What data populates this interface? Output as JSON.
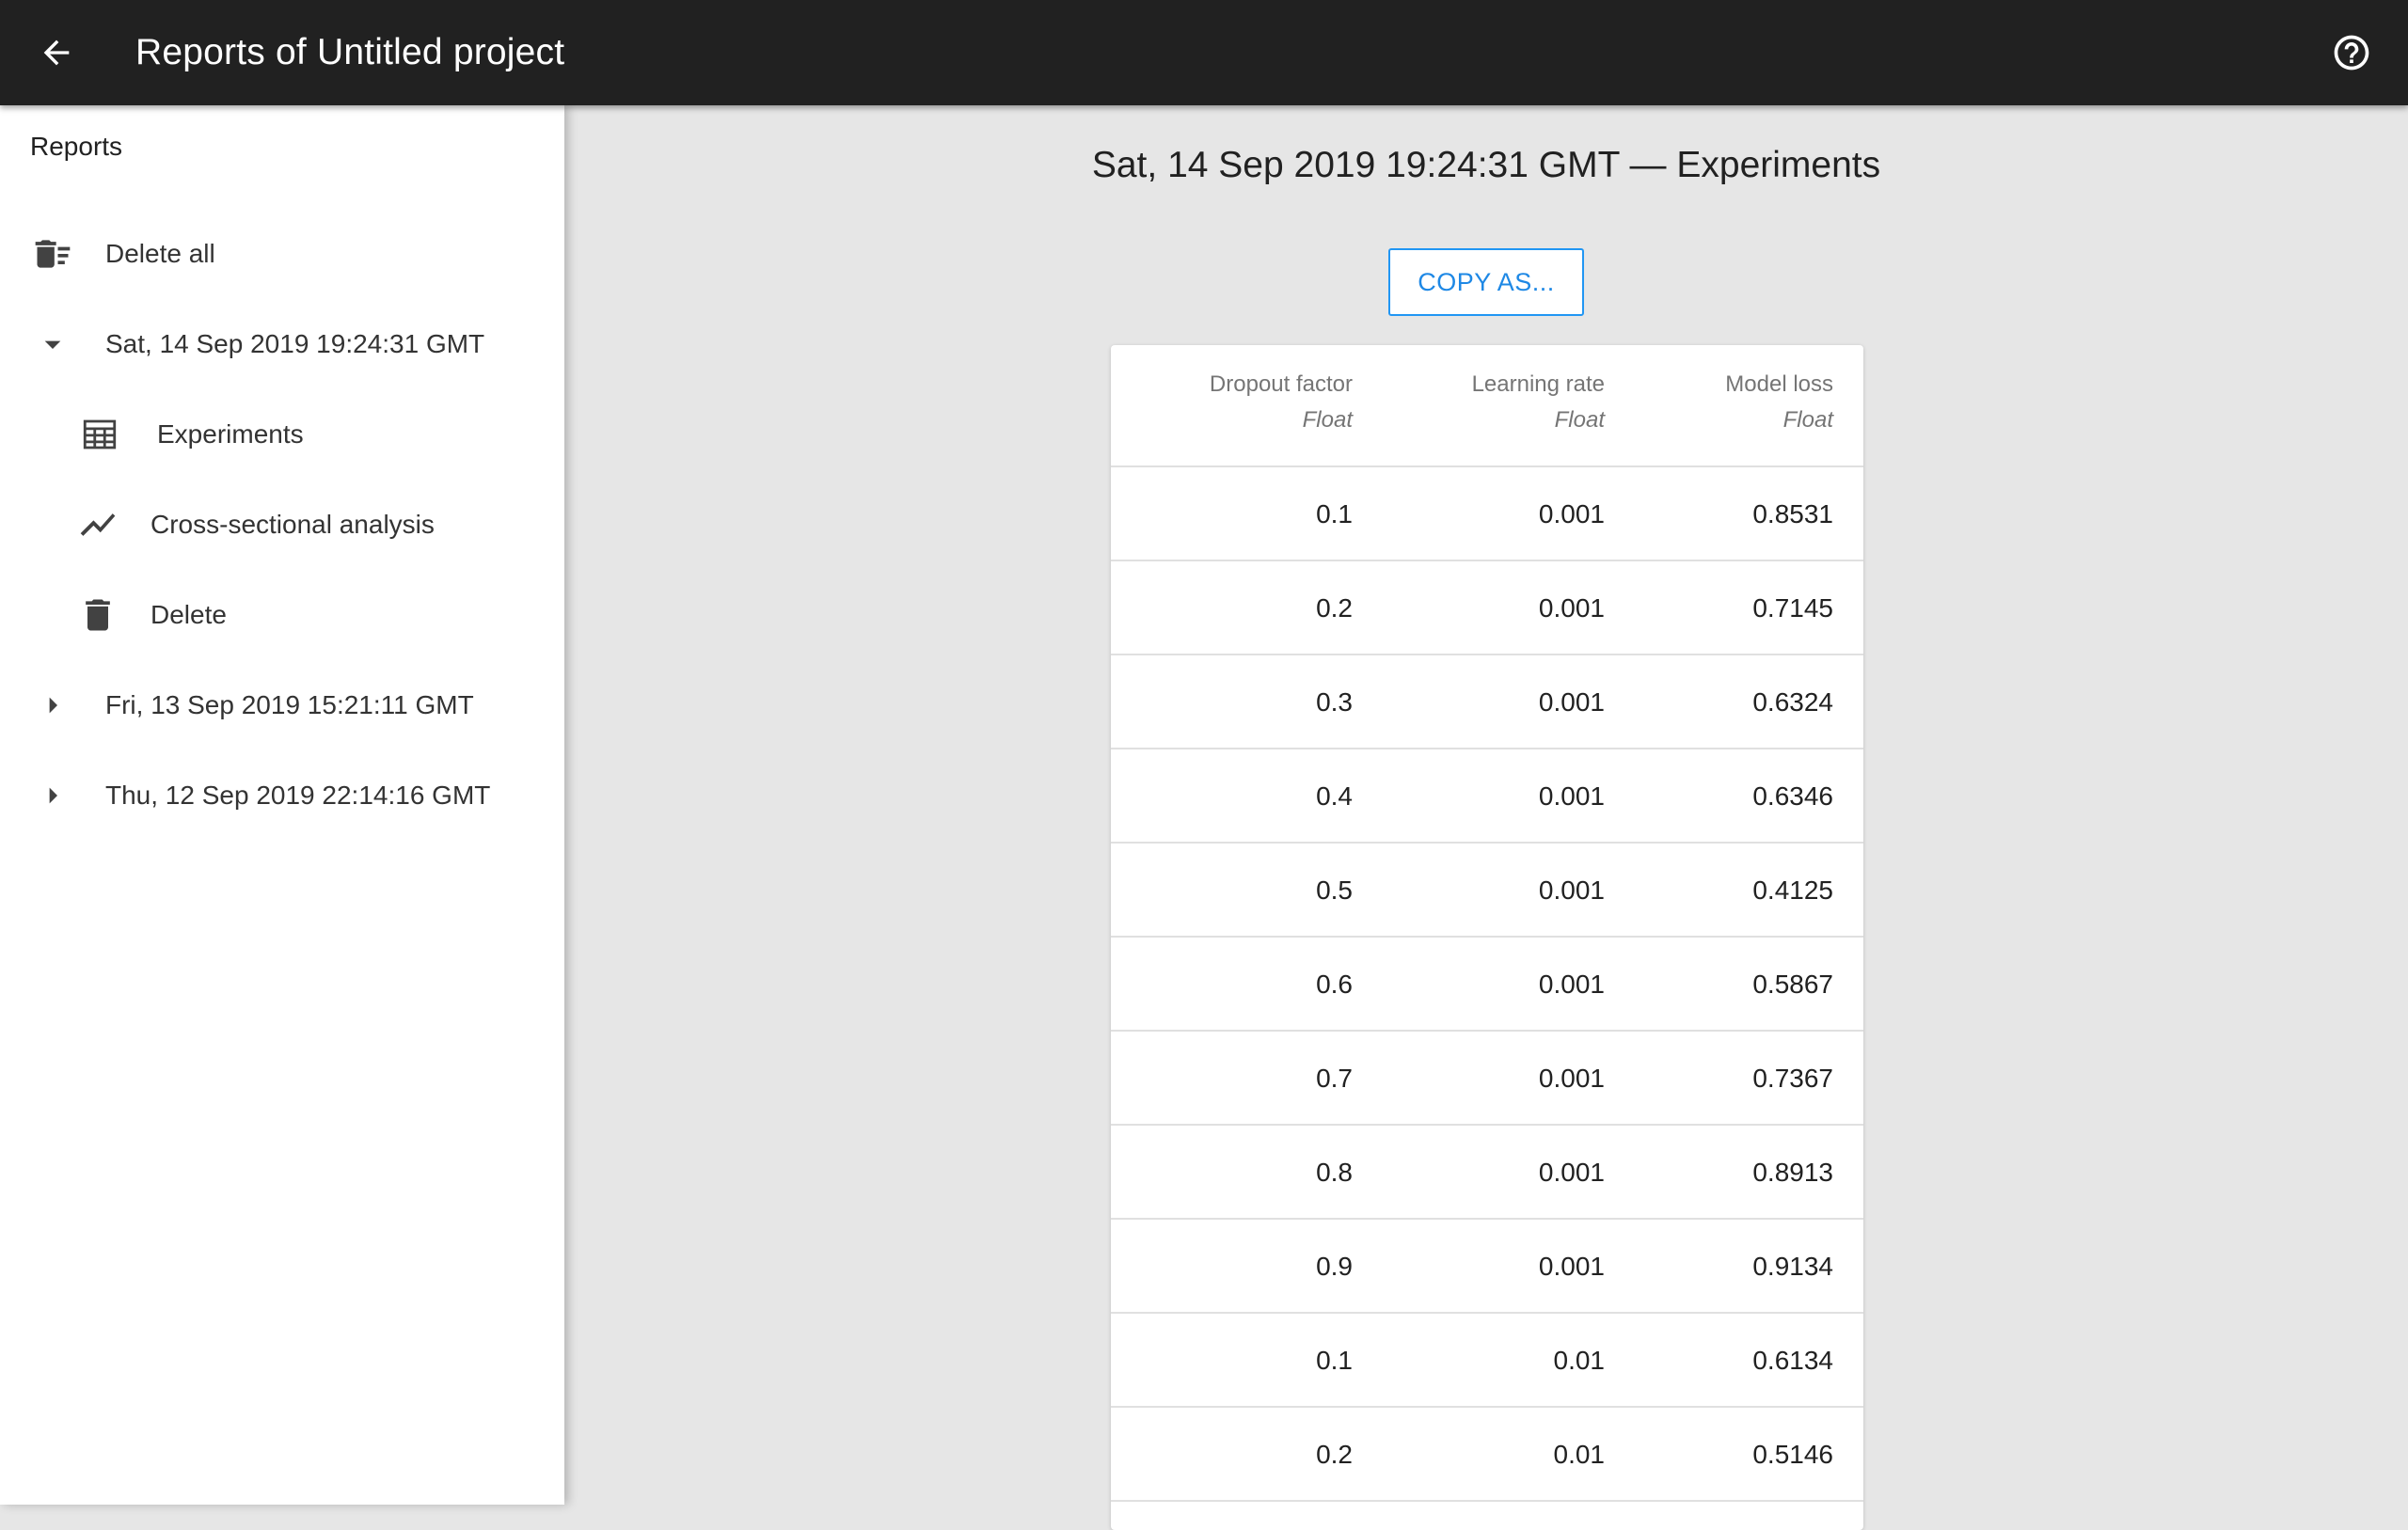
{
  "appbar": {
    "title": "Reports of Untitled project",
    "back_icon": "arrow-back-icon",
    "help_icon": "help-circle-icon"
  },
  "sidebar": {
    "section_title": "Reports",
    "delete_all_label": "Delete all",
    "reports": [
      {
        "label": "Sat, 14 Sep 2019 19:24:31 GMT",
        "expanded": true,
        "children": [
          {
            "label": "Experiments",
            "icon": "table-icon"
          },
          {
            "label": "Cross-sectional analysis",
            "icon": "chart-line-icon"
          },
          {
            "label": "Delete",
            "icon": "trash-icon"
          }
        ]
      },
      {
        "label": "Fri, 13 Sep 2019 15:21:11 GMT",
        "expanded": false
      },
      {
        "label": "Thu, 12 Sep 2019 22:14:16 GMT",
        "expanded": false
      }
    ]
  },
  "main": {
    "title": "Sat, 14 Sep 2019 19:24:31 GMT — Experiments",
    "copy_button": "COPY AS...",
    "table": {
      "columns": [
        {
          "name": "Dropout factor",
          "type": "Float"
        },
        {
          "name": "Learning rate",
          "type": "Float"
        },
        {
          "name": "Model loss",
          "type": "Float"
        }
      ],
      "rows": [
        [
          "0.1",
          "0.001",
          "0.8531"
        ],
        [
          "0.2",
          "0.001",
          "0.7145"
        ],
        [
          "0.3",
          "0.001",
          "0.6324"
        ],
        [
          "0.4",
          "0.001",
          "0.6346"
        ],
        [
          "0.5",
          "0.001",
          "0.4125"
        ],
        [
          "0.6",
          "0.001",
          "0.5867"
        ],
        [
          "0.7",
          "0.001",
          "0.7367"
        ],
        [
          "0.8",
          "0.001",
          "0.8913"
        ],
        [
          "0.9",
          "0.001",
          "0.9134"
        ],
        [
          "0.1",
          "0.01",
          "0.6134"
        ],
        [
          "0.2",
          "0.01",
          "0.5146"
        ]
      ]
    }
  },
  "colors": {
    "appbar": "#212121",
    "accent": "#1e88e5",
    "background": "#e6e6e6"
  }
}
